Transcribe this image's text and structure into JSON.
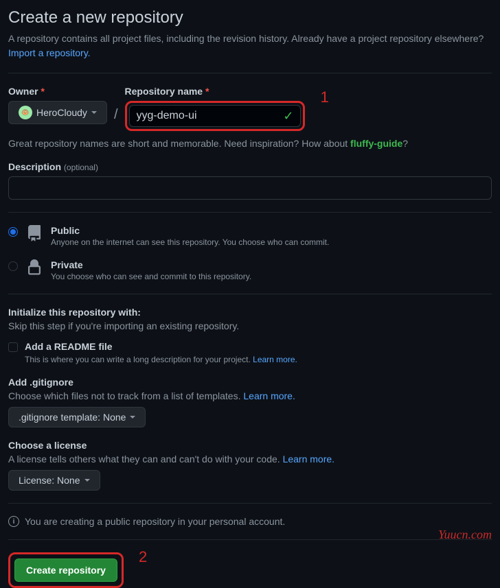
{
  "header": {
    "title": "Create a new repository",
    "subtitle_prefix": "A repository contains all project files, including the revision history. Already have a project repository elsewhere? ",
    "import_link": "Import a repository."
  },
  "owner": {
    "label": "Owner",
    "value": "HeroCloudy"
  },
  "repo": {
    "label": "Repository name",
    "value": "yyg-demo-ui"
  },
  "name_hint": {
    "prefix": "Great repository names are short and memorable. Need inspiration? How about ",
    "suggestion": "fluffy-guide",
    "suffix": "?"
  },
  "description": {
    "label": "Description",
    "optional": "(optional)"
  },
  "visibility": {
    "public": {
      "title": "Public",
      "desc": "Anyone on the internet can see this repository. You choose who can commit."
    },
    "private": {
      "title": "Private",
      "desc": "You choose who can see and commit to this repository."
    }
  },
  "init": {
    "title": "Initialize this repository with:",
    "sub": "Skip this step if you're importing an existing repository."
  },
  "readme": {
    "label": "Add a README file",
    "desc_prefix": "This is where you can write a long description for your project. ",
    "learn": "Learn more."
  },
  "gitignore": {
    "title": "Add .gitignore",
    "desc_prefix": "Choose which files not to track from a list of templates. ",
    "learn": "Learn more.",
    "dropdown": ".gitignore template: None"
  },
  "license": {
    "title": "Choose a license",
    "desc_prefix": "A license tells others what they can and can't do with your code. ",
    "learn": "Learn more.",
    "dropdown": "License: None"
  },
  "info_text": "You are creating a public repository in your personal account.",
  "create_button": "Create repository",
  "annotations": {
    "one": "1",
    "two": "2"
  },
  "watermark": "Yuucn.com"
}
